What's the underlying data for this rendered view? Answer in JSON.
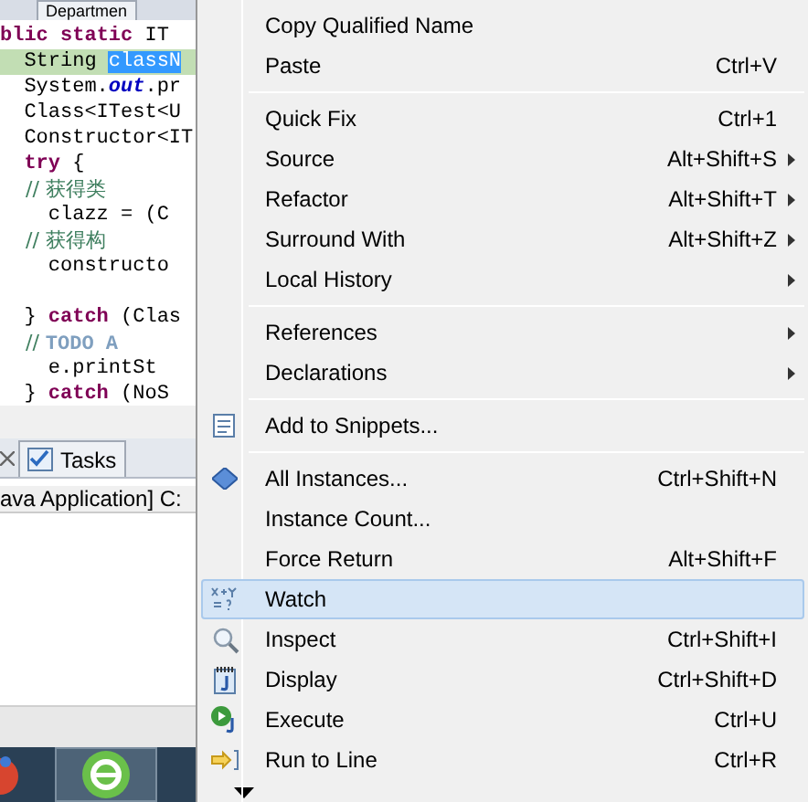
{
  "editor_tab": {
    "label": "Departmen"
  },
  "code_lines": [
    {
      "current": false,
      "segments": [
        {
          "text": "blic ",
          "kind": "keyword"
        },
        {
          "text": "static ",
          "kind": "keyword"
        },
        {
          "text": "IT",
          "kind": "plain"
        }
      ]
    },
    {
      "current": true,
      "segments": [
        {
          "text": "  String ",
          "kind": "plain"
        },
        {
          "text": "classN",
          "kind": "selection"
        }
      ]
    },
    {
      "current": false,
      "segments": [
        {
          "text": "  System.",
          "kind": "plain"
        },
        {
          "text": "out",
          "kind": "field"
        },
        {
          "text": ".pr",
          "kind": "plain"
        }
      ]
    },
    {
      "current": false,
      "segments": [
        {
          "text": "  Class<ITest<U",
          "kind": "plain"
        }
      ]
    },
    {
      "current": false,
      "segments": [
        {
          "text": "  Constructor<IT",
          "kind": "plain"
        }
      ]
    },
    {
      "current": false,
      "segments": [
        {
          "text": "  try ",
          "kind": "keyword"
        },
        {
          "text": "{",
          "kind": "plain"
        }
      ]
    },
    {
      "current": false,
      "segments": [
        {
          "text": "    // 获得类",
          "kind": "comment"
        }
      ]
    },
    {
      "current": false,
      "segments": [
        {
          "text": "    clazz = (C",
          "kind": "plain"
        }
      ]
    },
    {
      "current": false,
      "segments": [
        {
          "text": "    // 获得构",
          "kind": "comment"
        }
      ]
    },
    {
      "current": false,
      "segments": [
        {
          "text": "    constructo",
          "kind": "plain"
        }
      ]
    },
    {
      "current": false
    },
    {
      "current": false,
      "segments": [
        {
          "text": "  } ",
          "kind": "plain"
        },
        {
          "text": "catch ",
          "kind": "keyword"
        },
        {
          "text": "(Clas",
          "kind": "plain"
        }
      ]
    },
    {
      "current": false,
      "segments": [
        {
          "text": "    // ",
          "kind": "comment"
        },
        {
          "text": "TODO A",
          "kind": "todo"
        }
      ]
    },
    {
      "current": false,
      "segments": [
        {
          "text": "    e.printSt",
          "kind": "plain"
        }
      ]
    },
    {
      "current": false,
      "segments": [
        {
          "text": "  } ",
          "kind": "plain"
        },
        {
          "text": "catch ",
          "kind": "keyword"
        },
        {
          "text": "(NoS",
          "kind": "plain"
        }
      ]
    }
  ],
  "bottom_tabs": [
    {
      "label": "Tasks",
      "selected": false
    }
  ],
  "console_line": "ava Application] C:",
  "context_menu": [
    {
      "kind": "item",
      "label": "Copy Qualified Name",
      "selected": false,
      "submenu": false
    },
    {
      "kind": "item",
      "label": "Paste",
      "shortcut": "Ctrl+V",
      "selected": false,
      "submenu": false
    },
    {
      "kind": "separator"
    },
    {
      "kind": "item",
      "label": "Quick Fix",
      "shortcut": "Ctrl+1",
      "selected": false,
      "submenu": false
    },
    {
      "kind": "item",
      "label": "Source",
      "shortcut": "Alt+Shift+S",
      "selected": false,
      "submenu": true
    },
    {
      "kind": "item",
      "label": "Refactor",
      "shortcut": "Alt+Shift+T",
      "selected": false,
      "submenu": true
    },
    {
      "kind": "item",
      "label": "Surround With",
      "shortcut": "Alt+Shift+Z",
      "selected": false,
      "submenu": true
    },
    {
      "kind": "item",
      "label": "Local History",
      "selected": false,
      "submenu": true
    },
    {
      "kind": "separator"
    },
    {
      "kind": "item",
      "label": "References",
      "selected": false,
      "submenu": true
    },
    {
      "kind": "item",
      "label": "Declarations",
      "selected": false,
      "submenu": true
    },
    {
      "kind": "separator"
    },
    {
      "kind": "item",
      "label": "Add to Snippets...",
      "selected": false,
      "submenu": false
    },
    {
      "kind": "separator"
    },
    {
      "kind": "item",
      "label": "All Instances...",
      "shortcut": "Ctrl+Shift+N",
      "selected": false,
      "submenu": false
    },
    {
      "kind": "item",
      "label": "Instance Count...",
      "selected": false,
      "submenu": false
    },
    {
      "kind": "item",
      "label": "Force Return",
      "shortcut": "Alt+Shift+F",
      "selected": false,
      "submenu": false
    },
    {
      "kind": "item",
      "label": "Watch",
      "selected": true,
      "submenu": false
    },
    {
      "kind": "item",
      "label": "Inspect",
      "shortcut": "Ctrl+Shift+I",
      "selected": false,
      "submenu": false
    },
    {
      "kind": "item",
      "label": "Display",
      "shortcut": "Ctrl+Shift+D",
      "selected": false,
      "submenu": false
    },
    {
      "kind": "item",
      "label": "Execute",
      "shortcut": "Ctrl+U",
      "selected": false,
      "submenu": false
    },
    {
      "kind": "item",
      "label": "Run to Line",
      "shortcut": "Ctrl+R",
      "selected": false,
      "submenu": false
    }
  ]
}
